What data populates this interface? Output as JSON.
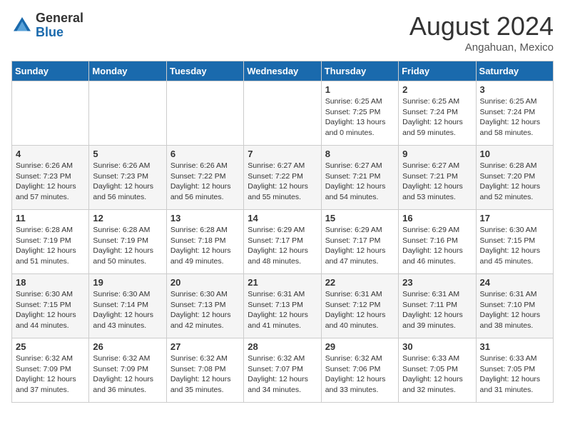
{
  "header": {
    "logo_general": "General",
    "logo_blue": "Blue",
    "month_year": "August 2024",
    "location": "Angahuan, Mexico"
  },
  "days_of_week": [
    "Sunday",
    "Monday",
    "Tuesday",
    "Wednesday",
    "Thursday",
    "Friday",
    "Saturday"
  ],
  "weeks": [
    [
      {
        "day": "",
        "sunrise": "",
        "sunset": "",
        "daylight": ""
      },
      {
        "day": "",
        "sunrise": "",
        "sunset": "",
        "daylight": ""
      },
      {
        "day": "",
        "sunrise": "",
        "sunset": "",
        "daylight": ""
      },
      {
        "day": "",
        "sunrise": "",
        "sunset": "",
        "daylight": ""
      },
      {
        "day": "1",
        "sunrise": "Sunrise: 6:25 AM",
        "sunset": "Sunset: 7:25 PM",
        "daylight": "Daylight: 13 hours and 0 minutes."
      },
      {
        "day": "2",
        "sunrise": "Sunrise: 6:25 AM",
        "sunset": "Sunset: 7:24 PM",
        "daylight": "Daylight: 12 hours and 59 minutes."
      },
      {
        "day": "3",
        "sunrise": "Sunrise: 6:25 AM",
        "sunset": "Sunset: 7:24 PM",
        "daylight": "Daylight: 12 hours and 58 minutes."
      }
    ],
    [
      {
        "day": "4",
        "sunrise": "Sunrise: 6:26 AM",
        "sunset": "Sunset: 7:23 PM",
        "daylight": "Daylight: 12 hours and 57 minutes."
      },
      {
        "day": "5",
        "sunrise": "Sunrise: 6:26 AM",
        "sunset": "Sunset: 7:23 PM",
        "daylight": "Daylight: 12 hours and 56 minutes."
      },
      {
        "day": "6",
        "sunrise": "Sunrise: 6:26 AM",
        "sunset": "Sunset: 7:22 PM",
        "daylight": "Daylight: 12 hours and 56 minutes."
      },
      {
        "day": "7",
        "sunrise": "Sunrise: 6:27 AM",
        "sunset": "Sunset: 7:22 PM",
        "daylight": "Daylight: 12 hours and 55 minutes."
      },
      {
        "day": "8",
        "sunrise": "Sunrise: 6:27 AM",
        "sunset": "Sunset: 7:21 PM",
        "daylight": "Daylight: 12 hours and 54 minutes."
      },
      {
        "day": "9",
        "sunrise": "Sunrise: 6:27 AM",
        "sunset": "Sunset: 7:21 PM",
        "daylight": "Daylight: 12 hours and 53 minutes."
      },
      {
        "day": "10",
        "sunrise": "Sunrise: 6:28 AM",
        "sunset": "Sunset: 7:20 PM",
        "daylight": "Daylight: 12 hours and 52 minutes."
      }
    ],
    [
      {
        "day": "11",
        "sunrise": "Sunrise: 6:28 AM",
        "sunset": "Sunset: 7:19 PM",
        "daylight": "Daylight: 12 hours and 51 minutes."
      },
      {
        "day": "12",
        "sunrise": "Sunrise: 6:28 AM",
        "sunset": "Sunset: 7:19 PM",
        "daylight": "Daylight: 12 hours and 50 minutes."
      },
      {
        "day": "13",
        "sunrise": "Sunrise: 6:28 AM",
        "sunset": "Sunset: 7:18 PM",
        "daylight": "Daylight: 12 hours and 49 minutes."
      },
      {
        "day": "14",
        "sunrise": "Sunrise: 6:29 AM",
        "sunset": "Sunset: 7:17 PM",
        "daylight": "Daylight: 12 hours and 48 minutes."
      },
      {
        "day": "15",
        "sunrise": "Sunrise: 6:29 AM",
        "sunset": "Sunset: 7:17 PM",
        "daylight": "Daylight: 12 hours and 47 minutes."
      },
      {
        "day": "16",
        "sunrise": "Sunrise: 6:29 AM",
        "sunset": "Sunset: 7:16 PM",
        "daylight": "Daylight: 12 hours and 46 minutes."
      },
      {
        "day": "17",
        "sunrise": "Sunrise: 6:30 AM",
        "sunset": "Sunset: 7:15 PM",
        "daylight": "Daylight: 12 hours and 45 minutes."
      }
    ],
    [
      {
        "day": "18",
        "sunrise": "Sunrise: 6:30 AM",
        "sunset": "Sunset: 7:15 PM",
        "daylight": "Daylight: 12 hours and 44 minutes."
      },
      {
        "day": "19",
        "sunrise": "Sunrise: 6:30 AM",
        "sunset": "Sunset: 7:14 PM",
        "daylight": "Daylight: 12 hours and 43 minutes."
      },
      {
        "day": "20",
        "sunrise": "Sunrise: 6:30 AM",
        "sunset": "Sunset: 7:13 PM",
        "daylight": "Daylight: 12 hours and 42 minutes."
      },
      {
        "day": "21",
        "sunrise": "Sunrise: 6:31 AM",
        "sunset": "Sunset: 7:13 PM",
        "daylight": "Daylight: 12 hours and 41 minutes."
      },
      {
        "day": "22",
        "sunrise": "Sunrise: 6:31 AM",
        "sunset": "Sunset: 7:12 PM",
        "daylight": "Daylight: 12 hours and 40 minutes."
      },
      {
        "day": "23",
        "sunrise": "Sunrise: 6:31 AM",
        "sunset": "Sunset: 7:11 PM",
        "daylight": "Daylight: 12 hours and 39 minutes."
      },
      {
        "day": "24",
        "sunrise": "Sunrise: 6:31 AM",
        "sunset": "Sunset: 7:10 PM",
        "daylight": "Daylight: 12 hours and 38 minutes."
      }
    ],
    [
      {
        "day": "25",
        "sunrise": "Sunrise: 6:32 AM",
        "sunset": "Sunset: 7:09 PM",
        "daylight": "Daylight: 12 hours and 37 minutes."
      },
      {
        "day": "26",
        "sunrise": "Sunrise: 6:32 AM",
        "sunset": "Sunset: 7:09 PM",
        "daylight": "Daylight: 12 hours and 36 minutes."
      },
      {
        "day": "27",
        "sunrise": "Sunrise: 6:32 AM",
        "sunset": "Sunset: 7:08 PM",
        "daylight": "Daylight: 12 hours and 35 minutes."
      },
      {
        "day": "28",
        "sunrise": "Sunrise: 6:32 AM",
        "sunset": "Sunset: 7:07 PM",
        "daylight": "Daylight: 12 hours and 34 minutes."
      },
      {
        "day": "29",
        "sunrise": "Sunrise: 6:32 AM",
        "sunset": "Sunset: 7:06 PM",
        "daylight": "Daylight: 12 hours and 33 minutes."
      },
      {
        "day": "30",
        "sunrise": "Sunrise: 6:33 AM",
        "sunset": "Sunset: 7:05 PM",
        "daylight": "Daylight: 12 hours and 32 minutes."
      },
      {
        "day": "31",
        "sunrise": "Sunrise: 6:33 AM",
        "sunset": "Sunset: 7:05 PM",
        "daylight": "Daylight: 12 hours and 31 minutes."
      }
    ]
  ]
}
